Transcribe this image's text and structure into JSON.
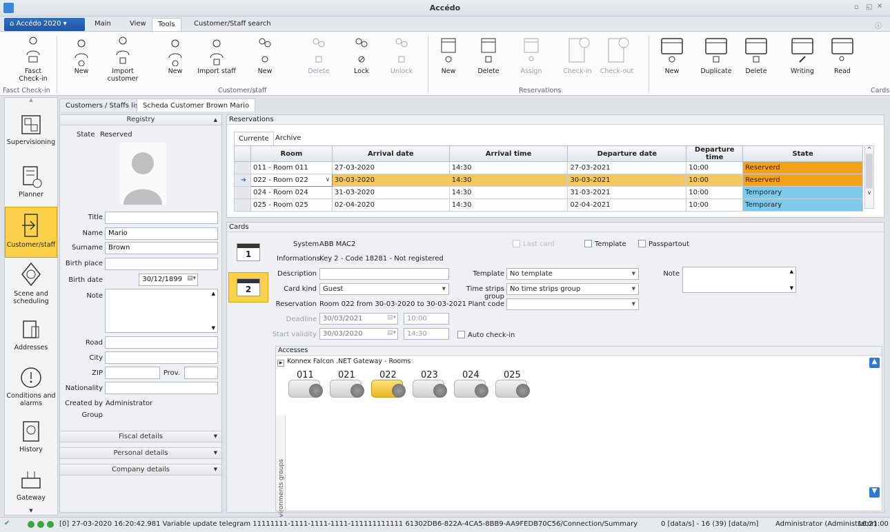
{
  "window": {
    "title": "Accédo"
  },
  "tabs": {
    "app": "Accédo 2020",
    "items": [
      "Main",
      "View",
      "Tools",
      "Customer/Staff search"
    ]
  },
  "ribbon": {
    "fasct_checkin": "Fasct Check-in",
    "fasct_group": "Fasct Check-in",
    "customer": {
      "new": "New",
      "import": "Import customer"
    },
    "staff": {
      "new": "New",
      "import": "Import staff"
    },
    "group_customer_staff": "Customer/staff",
    "access": {
      "new": "New",
      "delete": "Delete",
      "lock": "Lock",
      "unlock": "Unlock"
    },
    "reservations": {
      "new": "New",
      "delete": "Delete",
      "assign": "Assign",
      "checkin": "Check-in",
      "checkout": "Check-out"
    },
    "group_reservations": "Reservations",
    "cards": {
      "new": "New",
      "duplicate": "Duplicate",
      "delete": "Delete",
      "writing": "Writing",
      "read": "Read"
    },
    "group_cards": "Cards"
  },
  "nav": [
    {
      "label": "Supervisioning",
      "icon": "floorplan-icon"
    },
    {
      "label": "Planner",
      "icon": "planner-icon"
    },
    {
      "label": "Customer/staff",
      "icon": "door-enter-icon"
    },
    {
      "label": "Scene and scheduling",
      "icon": "scene-icon"
    },
    {
      "label": "Addresses",
      "icon": "addresses-icon"
    },
    {
      "label": "Conditions and alarms",
      "icon": "alarm-clock-icon"
    },
    {
      "label": "History",
      "icon": "history-icon"
    },
    {
      "label": "Gateway",
      "icon": "gateway-icon"
    }
  ],
  "doctabs": [
    "Customers / Staffs list",
    "Scheda Customer Brown Mario"
  ],
  "registry": {
    "header": "Registry",
    "state_label": "State",
    "state_value": "Reserved",
    "title_label": "Title",
    "title_value": "",
    "name_label": "Name",
    "name_value": "Mario",
    "surname_label": "Surname",
    "surname_value": "Brown",
    "birthplace_label": "Birth place",
    "birthplace_value": "",
    "birthdate_label": "Birth date",
    "birthdate_value": "30/12/1899",
    "note_label": "Note",
    "road_label": "Road",
    "city_label": "City",
    "zip_label": "ZIP",
    "prov_label": "Prov.",
    "nationality_label": "Nationality",
    "createdby_label": "Created by",
    "createdby_value": "Administrator",
    "group_label": "Group",
    "fiscal": "Fiscal details",
    "personal": "Personal details",
    "company": "Company details"
  },
  "reservations": {
    "header": "Reservations",
    "tabs": [
      "Currente",
      "Archive"
    ],
    "columns": [
      "Room",
      "Arrival date",
      "Arrival time",
      "Departure date",
      "Departure time",
      "State"
    ],
    "rows": [
      {
        "room": "011 - Room 011",
        "arrival_date": "27-03-2020",
        "arrival_time": "14:30",
        "departure_date": "27-03-2021",
        "departure_time": "10:00",
        "state": "Reserverd",
        "state_color": "#f5a21b"
      },
      {
        "room": "022 - Room 022",
        "arrival_date": "30-03-2020",
        "arrival_time": "14:30",
        "departure_date": "30-03-2021",
        "departure_time": "10:00",
        "state": "Reserverd",
        "state_color": "#f5a21b"
      },
      {
        "room": "024 - Room 024",
        "arrival_date": "31-03-2020",
        "arrival_time": "14:30",
        "departure_date": "31-03-2021",
        "departure_time": "10:00",
        "state": "Temporary",
        "state_color": "#7ccbef"
      },
      {
        "room": "025 - Room 025",
        "arrival_date": "02-04-2020",
        "arrival_time": "14:30",
        "departure_date": "02-04-2021",
        "departure_time": "10:00",
        "state": "Temporary",
        "state_color": "#7ccbef"
      }
    ]
  },
  "cards": {
    "header": "Cards",
    "card_buttons": [
      "1",
      "2"
    ],
    "system_label": "System",
    "system_value": "ABB MAC2",
    "lastcard": "Last card",
    "template_chk": "Template",
    "passpartout": "Passpartout",
    "info_label": "Informations",
    "info_value": "Key 2 - Code 18281 - Not registered",
    "description_label": "Description",
    "template_label": "Template",
    "template_value": "No template",
    "note_label": "Note",
    "cardkind_label": "Card kind",
    "cardkind_value": "Guest",
    "timestrips_label": "Time strips group",
    "timestrips_value": "No time strips group",
    "reservation_label": "Reservation",
    "reservation_value": "Room 022 from 30-03-2020 to 30-03-2021",
    "plantcode_label": "Plant code",
    "deadline_label": "Deadline",
    "deadline_date": "30/03/2021",
    "deadline_time": "10:00",
    "startvalidity_label": "Start validity",
    "startvalidity_date": "30/03/2020",
    "startvalidity_time": "14:30",
    "autocheckin": "Auto check-in",
    "accesses_header": "Accesses",
    "gateway_row": "Konnex Falcon .NET Gateway - Rooms",
    "env_groups": "Environments groups",
    "rooms": [
      "011",
      "021",
      "022",
      "023",
      "024",
      "025"
    ]
  },
  "status": {
    "count": "[0]",
    "message": "27-03-2020 16:20:42.981 Variable update telegram 11111111-1111-1111-1111-111111111111 61302DB6-822A-4CA5-8BB9-AA9FEDB70C56/Connection/Summary Konnex Falcon .NET Gatew",
    "rate": "0 [data/s] - 16 (39) [data/m]",
    "user": "Administrator (Administrator)",
    "time": "16:21:00"
  }
}
